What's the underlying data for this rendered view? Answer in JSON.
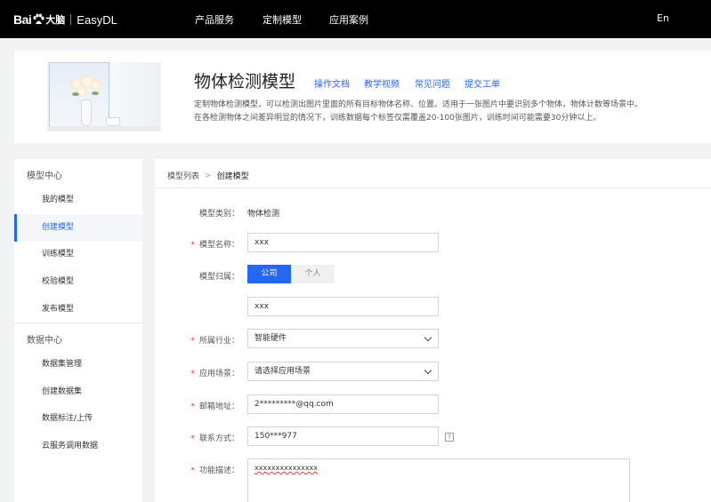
{
  "nav": {
    "logo_bai": "Bai",
    "logo_du": "大脑",
    "logo_product": "EasyDL",
    "items": [
      "产品服务",
      "定制模型",
      "应用案例"
    ],
    "lang": "En"
  },
  "banner": {
    "title": "物体检测模型",
    "links": [
      "操作文档",
      "教学视频",
      "常见问题",
      "提交工单"
    ],
    "desc_line1": "定制物体检测模型，可以检测出图片里面的所有目标物体名称、位置。适用于一张图片中要识别多个物体，物体计数等场景中。",
    "desc_line2": "在各检测物体之间差异明显的情况下，训练数据每个标签仅需覆盖20-100张图片，训练时间可能需要30分钟以上。"
  },
  "sidebar": {
    "group1": "模型中心",
    "group1_items": [
      "我的模型",
      "创建模型",
      "训练模型",
      "校验模型",
      "发布模型"
    ],
    "group2": "数据中心",
    "group2_items": [
      "数据集管理",
      "创建数据集",
      "数据标注/上传",
      "云服务调用数据"
    ],
    "active_index": 1
  },
  "breadcrumb": {
    "parent": "模型列表",
    "separator": ">",
    "current": "创建模型"
  },
  "form": {
    "type_label": "模型类别：",
    "type_value": "物体检测",
    "name_label": "模型名称：",
    "name_value": "xxx",
    "owner_label": "模型归属：",
    "owner_options": [
      "公司",
      "个人"
    ],
    "owner_selected": "公司",
    "company_value": "xxx",
    "industry_label": "所属行业：",
    "industry_value": "智能硬件",
    "scene_label": "应用场景：",
    "scene_placeholder": "请选择应用场景",
    "email_label": "邮箱地址：",
    "email_value": "2*********@qq.com",
    "phone_label": "联系方式：",
    "phone_value": "150***977",
    "help_glyph": "?",
    "desc_label": "功能描述：",
    "desc_value": "xxxxxxxxxxxxxxx",
    "required_mark": "*"
  },
  "colors": {
    "accent": "#2468f2",
    "required": "#e4393c",
    "nav_bg": "#000000",
    "page_bg": "#f2f3f5"
  }
}
